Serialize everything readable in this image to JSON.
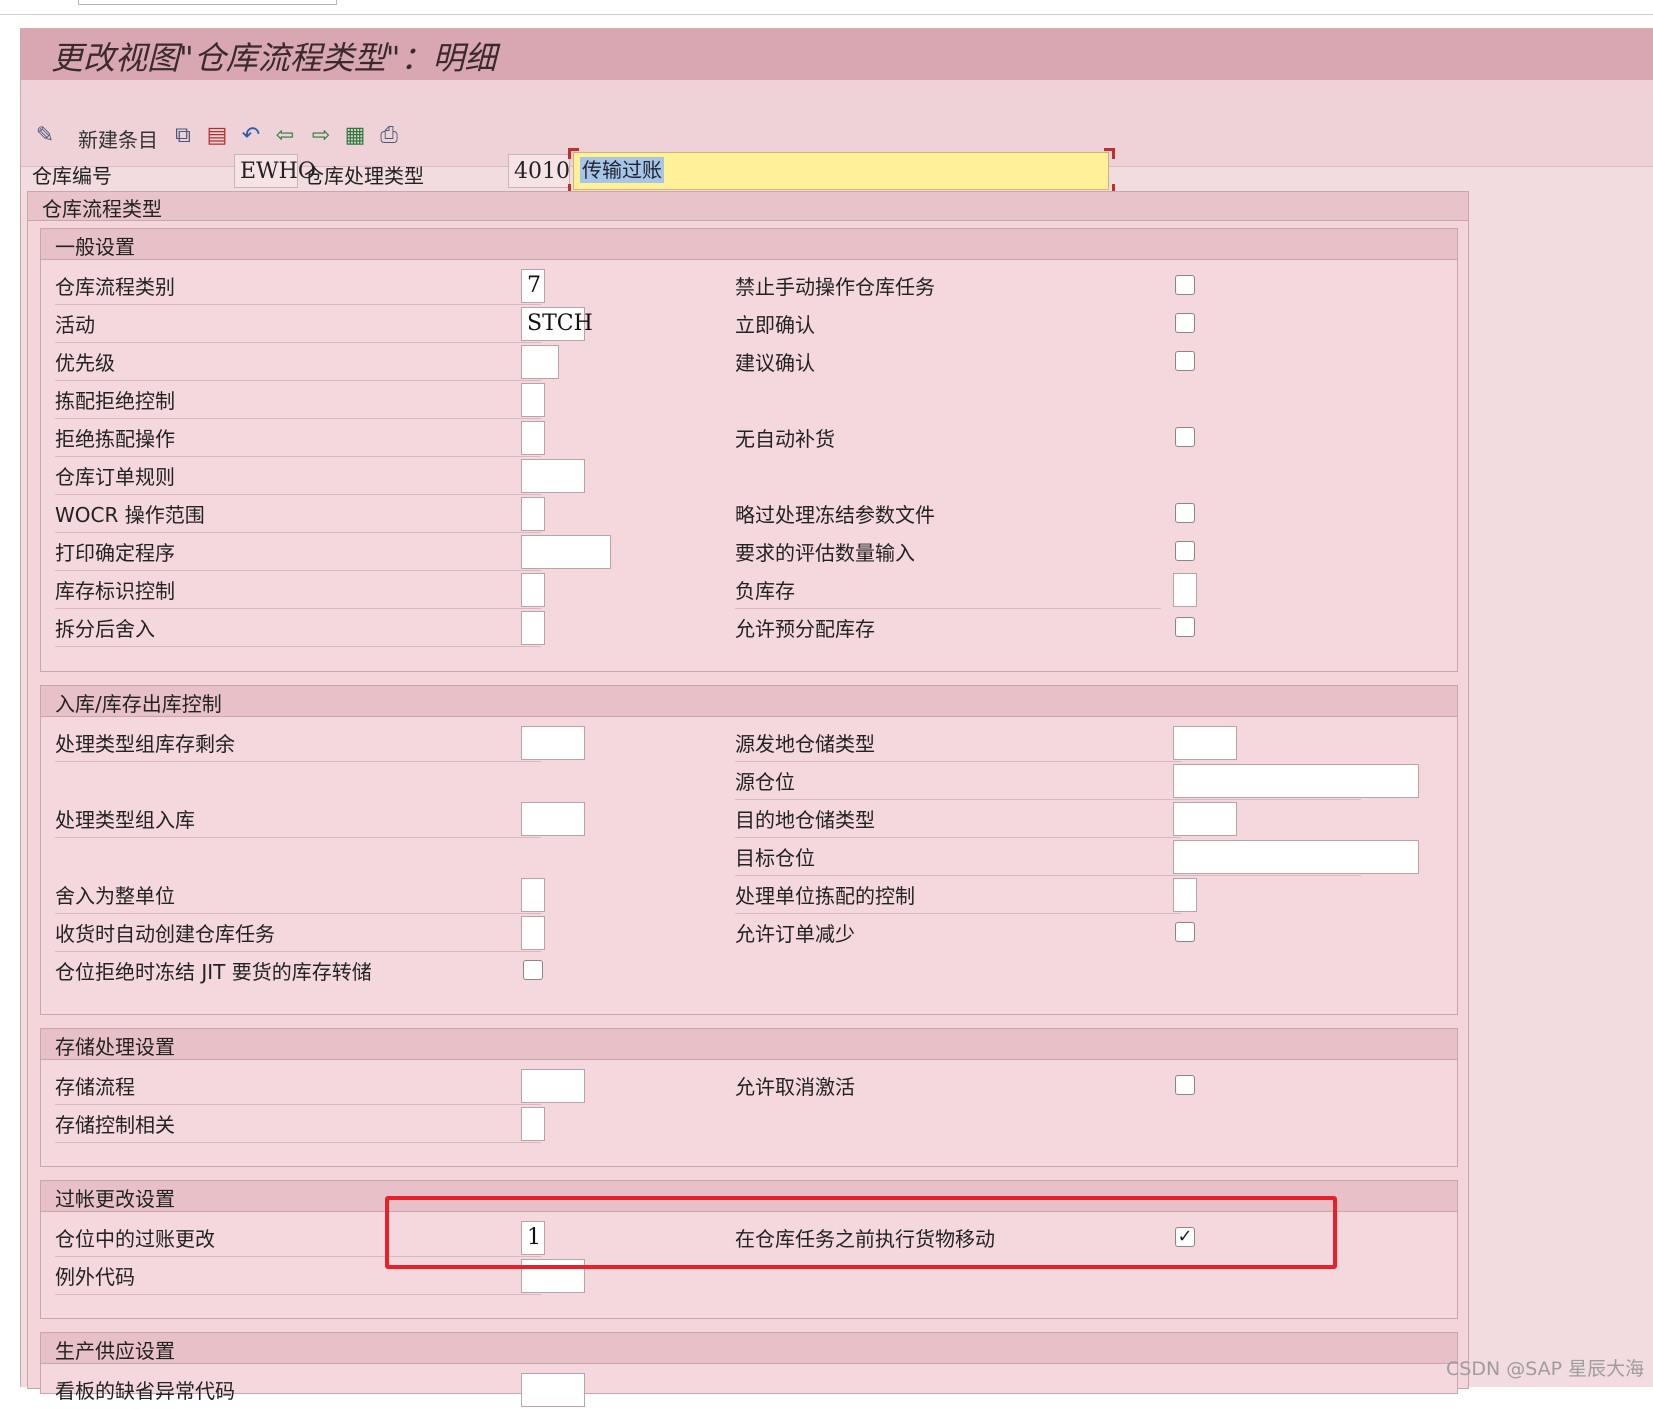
{
  "window": {
    "title": "更改视图\"仓库流程类型\"：明细"
  },
  "toolbar": {
    "new_entries": "新建条目",
    "icons": [
      "edit-pencil-icon",
      "copy-icon",
      "delete-icon",
      "undo-icon",
      "previous-entry-icon",
      "next-entry-icon",
      "select-all-icon",
      "print-icon"
    ]
  },
  "header": {
    "warehouse_label": "仓库编号",
    "warehouse_value": "EWHO",
    "process_type_label": "仓库处理类型",
    "process_type_value": "4010",
    "description": "传输过账"
  },
  "outer_title": "仓库流程类型",
  "general": {
    "title": "一般设置",
    "left": [
      {
        "label": "仓库流程类别",
        "value": "7"
      },
      {
        "label": "活动",
        "value": "STCH"
      },
      {
        "label": "优先级",
        "value": ""
      },
      {
        "label": "拣配拒绝控制",
        "value": ""
      },
      {
        "label": "拒绝拣配操作",
        "value": ""
      },
      {
        "label": "仓库订单规则",
        "value": ""
      },
      {
        "label": "WOCR 操作范围",
        "value": ""
      },
      {
        "label": "打印确定程序",
        "value": ""
      },
      {
        "label": "库存标识控制",
        "value": ""
      },
      {
        "label": "拆分后舍入",
        "value": ""
      }
    ],
    "right": [
      {
        "label": "禁止手动操作仓库任务",
        "checked": false
      },
      {
        "label": "立即确认",
        "checked": false
      },
      {
        "label": "建议确认",
        "checked": false
      },
      {
        "label": "无自动补货",
        "checked": false
      },
      {
        "label": "略过处理冻结参数文件",
        "checked": false
      },
      {
        "label": "要求的评估数量输入",
        "checked": false
      },
      {
        "label": "负库存",
        "value": ""
      },
      {
        "label": "允许预分配库存",
        "checked": false
      }
    ]
  },
  "inout": {
    "title": "入库/库存出库控制",
    "left": [
      {
        "label": "处理类型组库存剩余",
        "value": ""
      },
      {
        "label": "处理类型组入库",
        "value": ""
      },
      {
        "label": "舍入为整单位",
        "value": ""
      },
      {
        "label": "收货时自动创建仓库任务",
        "value": ""
      },
      {
        "label": "仓位拒绝时冻结 JIT 要货的库存转储",
        "checked": false
      }
    ],
    "right": [
      {
        "label": "源发地仓储类型",
        "value": ""
      },
      {
        "label": "源仓位",
        "value": ""
      },
      {
        "label": "目的地仓储类型",
        "value": ""
      },
      {
        "label": "目标仓位",
        "value": ""
      },
      {
        "label": "处理单位拣配的控制",
        "value": ""
      },
      {
        "label": "允许订单减少",
        "checked": false
      }
    ]
  },
  "storage": {
    "title": "存储处理设置",
    "left": [
      {
        "label": "存储流程",
        "value": ""
      },
      {
        "label": "存储控制相关",
        "value": ""
      }
    ],
    "right": [
      {
        "label": "允许取消激活",
        "checked": false
      }
    ]
  },
  "posting": {
    "title": "过帐更改设置",
    "left": [
      {
        "label": "仓位中的过账更改",
        "value": "1"
      },
      {
        "label": "例外代码",
        "value": ""
      }
    ],
    "right": [
      {
        "label": "在仓库任务之前执行货物移动",
        "checked": true
      }
    ]
  },
  "production": {
    "title": "生产供应设置",
    "left": [
      {
        "label": "看板的缺省异常代码",
        "value": ""
      }
    ]
  },
  "watermark": "CSDN @SAP 星辰大海",
  "colors": {
    "title_bar": "#d9a7b2",
    "background": "#f3dce0",
    "highlight_field": "#fff099",
    "selection": "#a7c6e6",
    "annotation_red": "#e8202a"
  }
}
